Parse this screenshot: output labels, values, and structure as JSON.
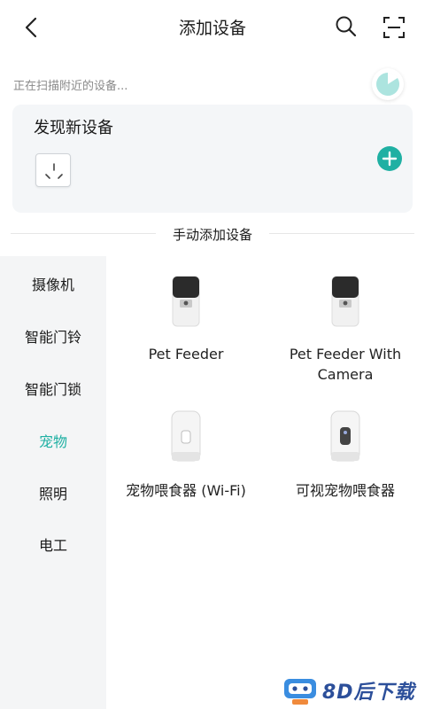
{
  "header": {
    "title": "添加设备",
    "back_icon": "chevron-left-icon",
    "search_icon": "search-icon",
    "scan_icon": "scan-icon"
  },
  "scan": {
    "status_text": "正在扫描附近的设备..."
  },
  "discover": {
    "title": "发现新设备",
    "device_icon": "socket-icon",
    "add_icon": "plus-icon"
  },
  "manual": {
    "label": "手动添加设备"
  },
  "categories": [
    {
      "label": "摄像机",
      "active": false
    },
    {
      "label": "智能门铃",
      "active": false
    },
    {
      "label": "智能门锁",
      "active": false
    },
    {
      "label": "宠物",
      "active": true
    },
    {
      "label": "照明",
      "active": false
    },
    {
      "label": "电工",
      "active": false
    }
  ],
  "devices": [
    {
      "name_line1": "Pet Feeder",
      "name_line2": ""
    },
    {
      "name_line1": "Pet Feeder With",
      "name_line2": "Camera"
    },
    {
      "name_line1": "宠物喂食器 (Wi-Fi)",
      "name_line2": ""
    },
    {
      "name_line1": "可视宠物喂食器",
      "name_line2": ""
    }
  ],
  "watermark": {
    "text": "8D后下载"
  },
  "colors": {
    "accent": "#1fb0a3",
    "sidebar_bg": "#f4f5f6",
    "card_bg": "#f4f6f8"
  }
}
